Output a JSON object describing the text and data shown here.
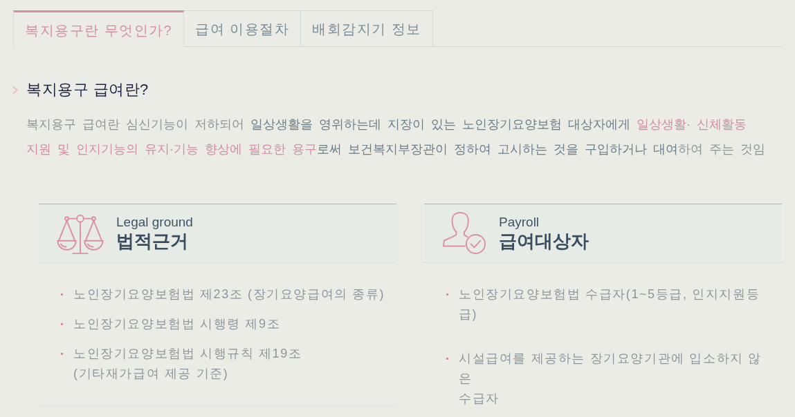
{
  "tabs": [
    {
      "label": "복지용구란 무엇인가?",
      "selected": true
    },
    {
      "label": "급여 이용절차",
      "selected": false
    },
    {
      "label": "배회감지기 정보",
      "selected": false
    }
  ],
  "section": {
    "title": "복지용구 급여란?",
    "description": [
      {
        "kind": "plain",
        "text": "복지용구 급여란 심신기능이 저하되어 "
      },
      {
        "kind": "emphasis",
        "text": "일상생활을 영위하는데 지장이 있는 노인장기요양보험 대상자에게 "
      },
      {
        "kind": "highlight",
        "text": "일상생활· 신체활동 지원 및 인지기능의 유지·기능 향상에 필요한 용구"
      },
      {
        "kind": "emphasis",
        "text": "로써 보건복지부장관이 정하여 고시하는 것을 구입하거나 대여"
      },
      {
        "kind": "plain",
        "text": "하여 주는 것임"
      }
    ]
  },
  "cards": [
    {
      "subtitle": "Legal ground",
      "title": "법적근거",
      "items": [
        "노인장기요양보험법 제23조 (장기요양급여의 종류)",
        "노인장기요양보험법 시행령 제9조",
        "노인장기요양보험법 시행규칙 제19조\n(기타재가급여 제공 기준)"
      ]
    },
    {
      "subtitle": "Payroll",
      "title": "급여대상자",
      "items": [
        "노인장기요양보험법 수급자(1~5등급, 인지지원등급)",
        "시설급여를 제공하는 장기요양기관에 입소하지 않은\n수급자"
      ]
    }
  ]
}
